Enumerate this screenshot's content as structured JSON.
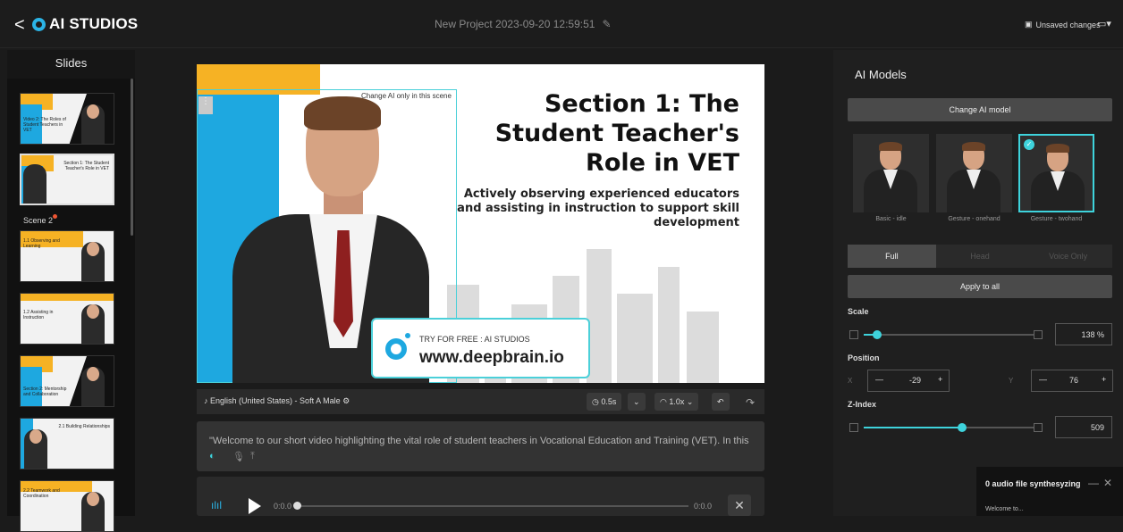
{
  "header": {
    "back": "<",
    "app_name": "AI STUDIOS",
    "project_title": "New Project 2023-09-20 12:59:51",
    "edit_icon": "edit-icon",
    "unsaved": "Unsaved changes",
    "view_icon": "layout-icon"
  },
  "slides_panel": {
    "title": "Slides",
    "scene_label": "Scene 2",
    "thumbs": [
      {
        "text": "Video 2: The Roles of Student Teachers in VET"
      },
      {
        "text": "Section 1: The Student Teacher's Role in VET"
      },
      {
        "text": "1.1 Observing and Learning"
      },
      {
        "text": "1.2 Assisting in Instruction"
      },
      {
        "text": "Section 2: Mentorship and Collaboration"
      },
      {
        "text": "2.1 Building Relationships"
      },
      {
        "text": "2.2 Teamwork and Coordination"
      }
    ]
  },
  "canvas": {
    "selection_label": "Change AI only in this scene",
    "title": "Section 1: The Student Teacher's Role in VET",
    "subtitle": "Actively observing experienced educators and assisting in instruction to support skill development",
    "promo_line1": "TRY FOR FREE : AI STUDIOS",
    "promo_line2": "www.deepbrain.io",
    "colors": {
      "accent_blue": "#1ea8e0",
      "accent_yellow": "#f6b224",
      "selection": "#4bd0d9"
    }
  },
  "voice": {
    "voice_label": "English (United States) - Soft A Male",
    "pause": "0.5s",
    "speed": "1.0x"
  },
  "script": {
    "text": "\"Welcome to our short video highlighting the vital role of student teachers in Vocational Education and Training (VET). In this"
  },
  "player": {
    "time_start": "0:0.0",
    "time_end": "0:0.0"
  },
  "right_panel": {
    "title": "AI Models",
    "change_model": "Change AI model",
    "models": [
      {
        "label": "Basic - idle"
      },
      {
        "label": "Gesture - onehand"
      },
      {
        "label": "Gesture - twohand"
      }
    ],
    "tabs": [
      "Full",
      "Head",
      "Voice Only"
    ],
    "apply_all": "Apply to all",
    "scale_label": "Scale",
    "scale_value": "138 %",
    "scale_fraction": 0.08,
    "position_label": "Position",
    "pos_x_axis": "X",
    "pos_y_axis": "Y",
    "pos_x": "-29",
    "pos_y": "76",
    "zindex_label": "Z-Index",
    "zindex_value": "509",
    "zindex_fraction": 0.58
  },
  "toast": {
    "text": "0 audio file synthesyzing",
    "minimize": "—",
    "close": "✕",
    "peek_text": "Welcome to..."
  }
}
